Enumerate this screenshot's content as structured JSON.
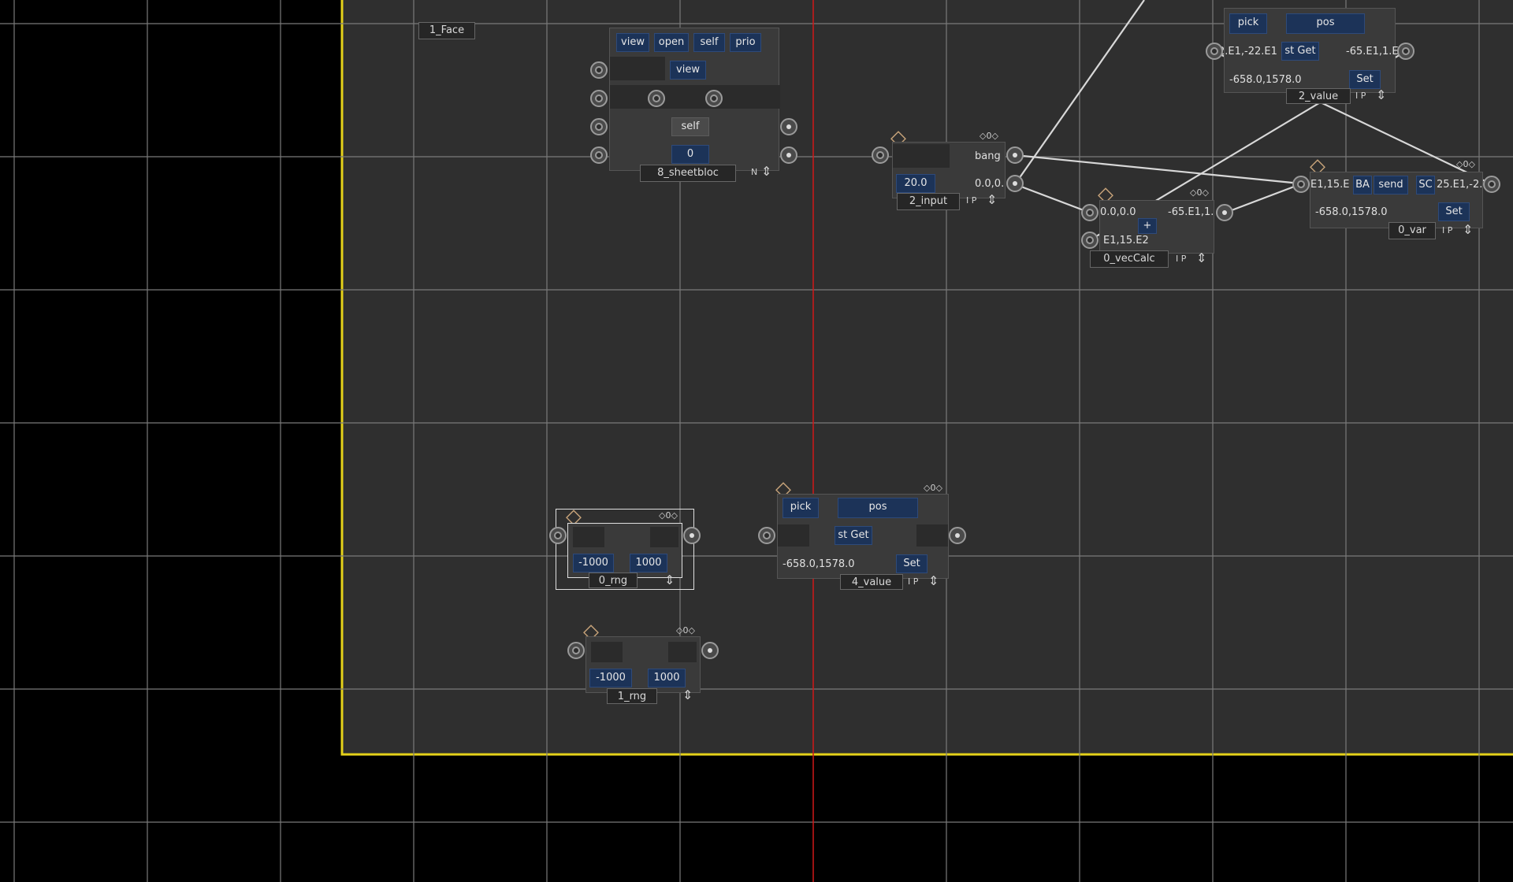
{
  "colors": {
    "background": "#000000",
    "workspace": "#2f2f2f",
    "workspace_border": "#e5d21a",
    "grid": "#777777",
    "red_line": "#d01818",
    "button_blue": "#1c3358",
    "diamond": "#c8a47a"
  },
  "labels": {
    "face": "1_Face"
  },
  "sheetbloc": {
    "name": "8_sheetbloc",
    "flag": "N",
    "buttons": [
      "view",
      "open",
      "self",
      "prio"
    ],
    "row_view": "view",
    "row_self": "self",
    "value": "0"
  },
  "input": {
    "name": "2_input",
    "bang": "bang",
    "value": "20.0",
    "out_value": "0.0,0.",
    "flags": "I P",
    "counter": "0"
  },
  "vecCalc": {
    "name": "0_vecCalc",
    "a": "0.0,0.0",
    "b": "-65.E1,1.",
    "op": "+",
    "c": "E1,15.E2",
    "flags": "I P",
    "counter": "0"
  },
  "value2": {
    "name": "2_value",
    "pick": "pick",
    "pos": "pos",
    "left": "2.E1,-22.E1",
    "get": "st Get",
    "right": "-65.E1,1.E2",
    "coords": "-658.0,1578.0",
    "set": "Set",
    "flags": "I P"
  },
  "var": {
    "name": "0_var",
    "left": "E1,15.E",
    "ba": "BA",
    "send": "send",
    "sc": "SC",
    "right": "25.E1,-2.",
    "coords": "-658.0,1578.0",
    "set": "Set",
    "flags": "I P",
    "counter": "0"
  },
  "rng0": {
    "name": "0_rng",
    "min": "-1000",
    "max": "1000",
    "counter": "0"
  },
  "rng1": {
    "name": "1_rng",
    "min": "-1000",
    "max": "1000",
    "counter": "0"
  },
  "value4": {
    "name": "4_value",
    "pick": "pick",
    "pos": "pos",
    "get": "st Get",
    "coords": "-658.0,1578.0",
    "set": "Set",
    "flags": "I P",
    "counter": "0"
  }
}
